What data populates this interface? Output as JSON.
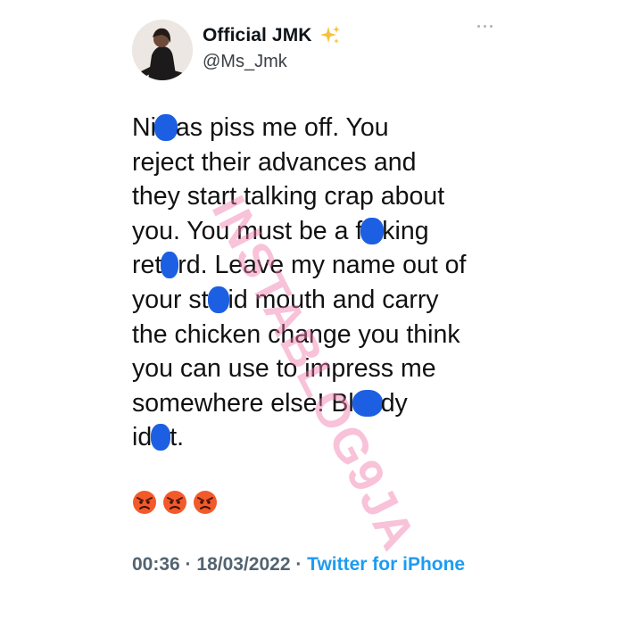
{
  "author": {
    "display_name": "Official JMK",
    "name_emoji_icon": "sparkles-icon",
    "handle": "@Ms_Jmk",
    "avatar_icon": "profile-photo"
  },
  "more_icon": "more-options-icon",
  "tweet": {
    "lines": [
      [
        "Ni",
        "",
        "as piss me off. You"
      ],
      [
        "reject their advances and"
      ],
      [
        "they start talking crap about"
      ],
      [
        "you. You must be a f",
        "",
        "king"
      ],
      [
        "ret",
        "",
        "rd. Leave my name out of"
      ],
      [
        "your st",
        "",
        "id mouth and carry"
      ],
      [
        "the chicken change you think"
      ],
      [
        "you can use to impress me"
      ],
      [
        "somewhere else! Bl",
        "",
        "dy"
      ],
      [
        "id",
        "",
        "t."
      ]
    ],
    "emojis": [
      "angry-face-icon",
      "angry-face-icon",
      "angry-face-icon"
    ]
  },
  "meta": {
    "time": "00:36",
    "sep1": " · ",
    "date": "18/03/2022",
    "sep2": " · ",
    "source": "Twitter for iPhone"
  },
  "watermark": "INSTABLOG9JA",
  "colors": {
    "censor_blob": "#1c5fe2",
    "link_blue": "#1d9bf0",
    "meta_gray": "#536471",
    "watermark_pink": "#f078aa"
  }
}
